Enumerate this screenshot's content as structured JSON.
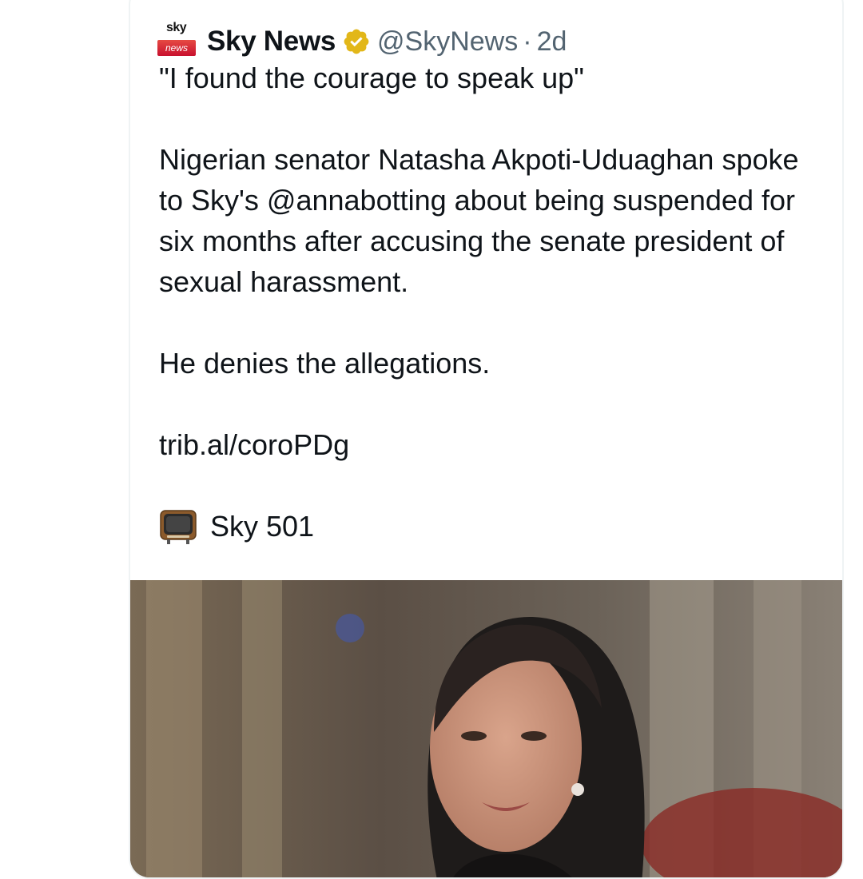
{
  "tweet": {
    "author_name": "Sky News",
    "handle": "@SkyNews",
    "separator": "·",
    "time": "2d",
    "logo": {
      "top_text": "sky",
      "bottom_text": "news"
    },
    "verified_icon": "verified-badge-icon",
    "paragraphs": [
      "\"I found the courage to speak up\"",
      "Nigerian senator Natasha Akpoti-Uduaghan spoke to Sky's @annabotting about being suspended for six months after accusing the senate president of sexual harassment.",
      "He denies the allegations.",
      "trib.al/coroPDg"
    ],
    "channel": {
      "icon": "television-icon",
      "label": "Sky 501"
    }
  },
  "colors": {
    "text": "#0f1419",
    "secondary_text": "#536471",
    "verified_gold": "#e2b719",
    "logo_red": "#c8102e",
    "card_border": "#eff3f4"
  }
}
